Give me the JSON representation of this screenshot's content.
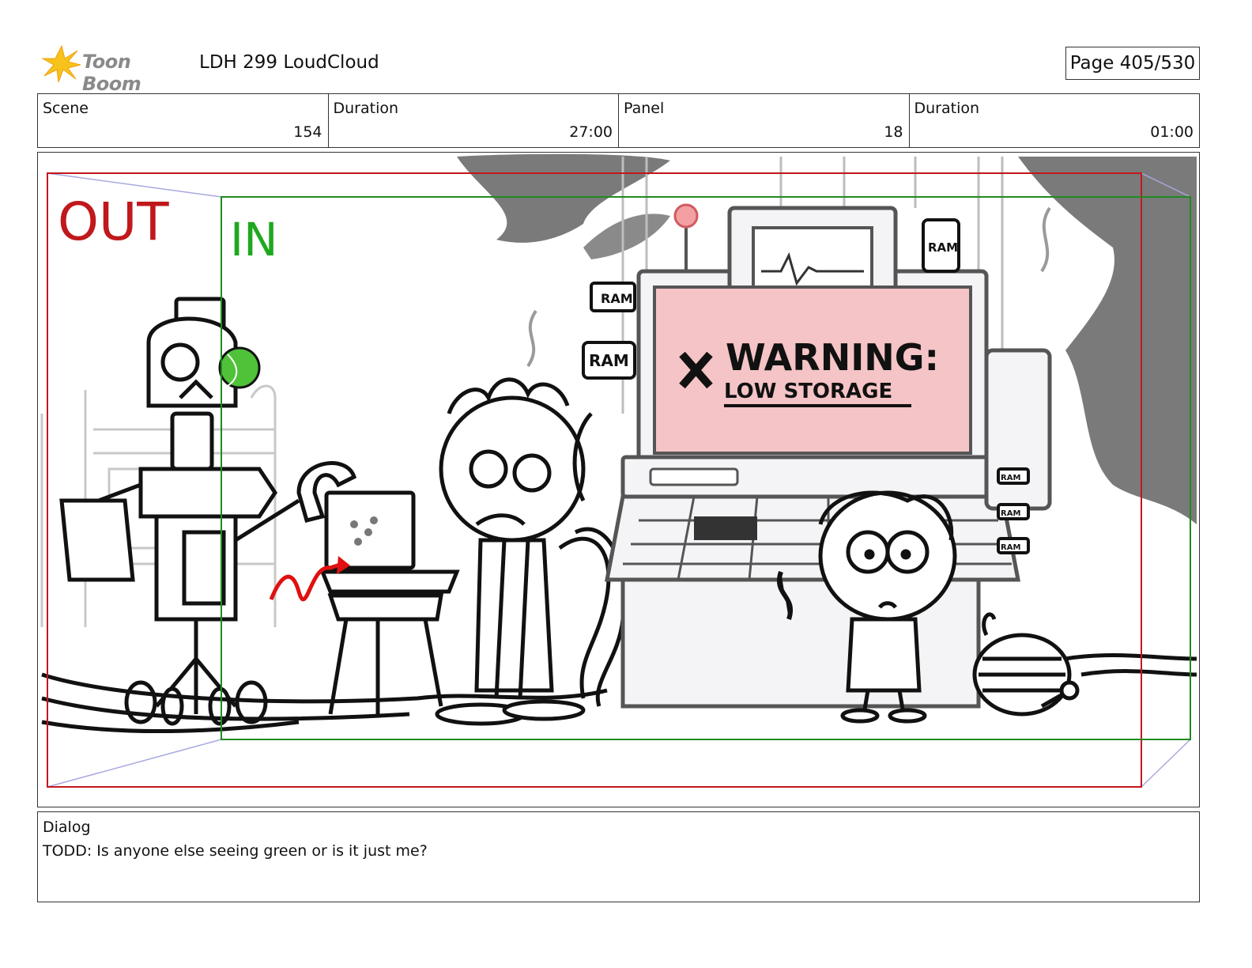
{
  "header": {
    "logo_text": "Toon Boom",
    "project_title": "LDH 299 LoudCloud",
    "page": "Page 405/530"
  },
  "info": [
    {
      "label": "Scene",
      "value": "154"
    },
    {
      "label": "Duration",
      "value": "27:00"
    },
    {
      "label": "Panel",
      "value": "18"
    },
    {
      "label": "Duration",
      "value": "01:00"
    }
  ],
  "panel": {
    "out_label": "OUT",
    "in_label": "IN",
    "warning_line1": "WARNING:",
    "warning_line2": "LOW STORAGE",
    "ram_labels": [
      "RAM",
      "RAM",
      "RAM",
      "RAM",
      "RAM",
      "RAM"
    ],
    "colors": {
      "out_frame": "#c0181c",
      "in_frame": "#1f8a1f",
      "screen": "#f5c4c6",
      "smoke": "#7a7a7a",
      "tennis_ball": "#4fc23a"
    }
  },
  "dialog": {
    "label": "Dialog",
    "text": "TODD: Is anyone else seeing green or is it just me?"
  }
}
